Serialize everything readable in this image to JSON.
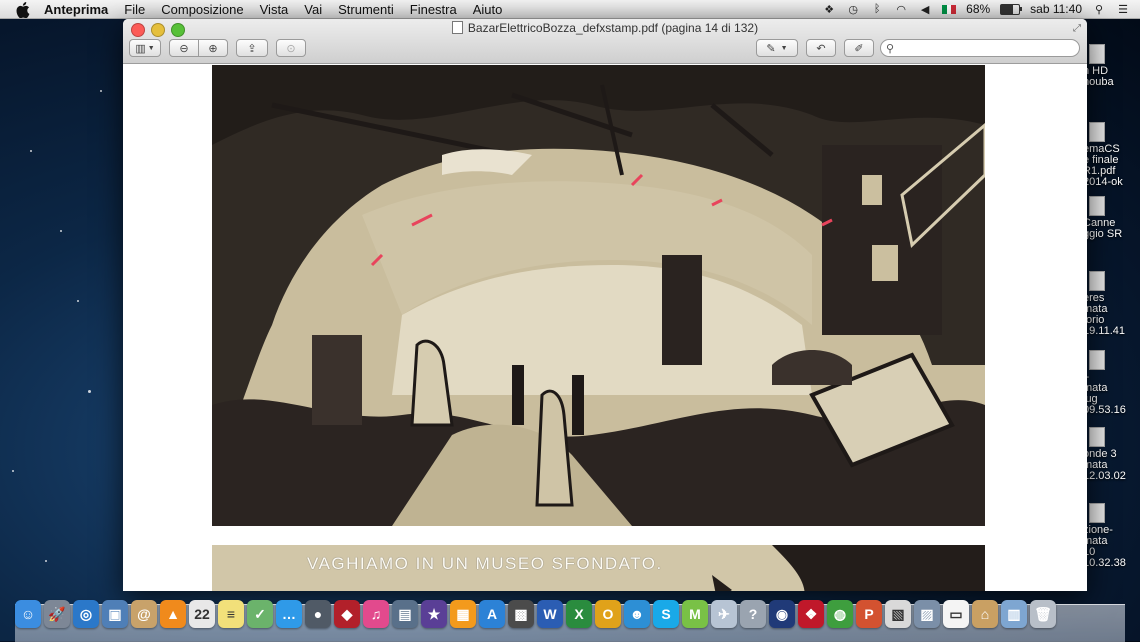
{
  "menubar": {
    "app_name": "Anteprima",
    "items": [
      "File",
      "Composizione",
      "Vista",
      "Vai",
      "Strumenti",
      "Finestra",
      "Aiuto"
    ],
    "battery_percent": "68%",
    "battery_level": 0.68,
    "clock": "sab 11:40",
    "flag_colors": [
      "#009246",
      "#ffffff",
      "#ce2b37"
    ]
  },
  "window": {
    "title": "BazarElettricoBozza_defxstamp.pdf (pagina 14 di 132)",
    "search_placeholder": ""
  },
  "page": {
    "caption": "VAGHIAMO IN UN MUSEO SFONDATO."
  },
  "desktop_icons": [
    {
      "lines": [
        "n HD",
        "houba"
      ]
    },
    {
      "lines": [
        "emaCS",
        "e finale",
        "R1.pdf",
        "2014-ok"
      ]
    },
    {
      "lines": [
        "Canne",
        "ggio SR"
      ]
    },
    {
      "lines": [
        "ères",
        "mata",
        "torio",
        "19.11.41"
      ]
    },
    {
      "lines": [
        "i-",
        "mata",
        "lug",
        "09.53.16"
      ]
    },
    {
      "lines": [
        "onde 3",
        "mata",
        "12.03.02"
      ]
    },
    {
      "lines": [
        "zione-",
        "mata",
        "10",
        "10.32.38"
      ]
    }
  ],
  "dock": {
    "apps": [
      {
        "name": "finder",
        "glyph": "☺",
        "color": "#3b8de0"
      },
      {
        "name": "launchpad",
        "glyph": "🚀",
        "color": "#7d8796"
      },
      {
        "name": "safari",
        "glyph": "◎",
        "color": "#2b78c9"
      },
      {
        "name": "preview",
        "glyph": "▣",
        "color": "#4f7fb7"
      },
      {
        "name": "contacts",
        "glyph": "@",
        "color": "#c8a26a"
      },
      {
        "name": "vlc",
        "glyph": "▲",
        "color": "#f08a1c"
      },
      {
        "name": "calendar",
        "glyph": "22",
        "color": "#e8e8e8"
      },
      {
        "name": "notes",
        "glyph": "≡",
        "color": "#f2e07a"
      },
      {
        "name": "maps",
        "glyph": "✓",
        "color": "#6bb36b"
      },
      {
        "name": "messages",
        "glyph": "…",
        "color": "#2f9ae8"
      },
      {
        "name": "facetime",
        "glyph": "●",
        "color": "#505a66"
      },
      {
        "name": "photo-booth",
        "glyph": "◆",
        "color": "#b2202a"
      },
      {
        "name": "itunes",
        "glyph": "♫",
        "color": "#e24a8d"
      },
      {
        "name": "iphoto",
        "glyph": "▤",
        "color": "#59708a"
      },
      {
        "name": "imovie",
        "glyph": "★",
        "color": "#5a3f96"
      },
      {
        "name": "ibooks",
        "glyph": "▦",
        "color": "#f39a1c"
      },
      {
        "name": "app-store",
        "glyph": "A",
        "color": "#2c82d6"
      },
      {
        "name": "mission-control",
        "glyph": "▩",
        "color": "#4b4b4b"
      },
      {
        "name": "word",
        "glyph": "W",
        "color": "#2b5db3"
      },
      {
        "name": "excel",
        "glyph": "X",
        "color": "#2a8c3e"
      },
      {
        "name": "outlook",
        "glyph": "O",
        "color": "#e0a21a"
      },
      {
        "name": "messenger",
        "glyph": "☻",
        "color": "#2d8fd5"
      },
      {
        "name": "skype",
        "glyph": "S",
        "color": "#19a9e8"
      },
      {
        "name": "movistar",
        "glyph": "M",
        "color": "#79c146"
      },
      {
        "name": "utility",
        "glyph": "✈",
        "color": "#b7c4d4"
      },
      {
        "name": "help",
        "glyph": "?",
        "color": "#9aa4b0"
      },
      {
        "name": "dvd-player",
        "glyph": "◉",
        "color": "#203a78"
      },
      {
        "name": "photo-app",
        "glyph": "❖",
        "color": "#c0182a"
      },
      {
        "name": "chrome",
        "glyph": "◍",
        "color": "#3e9e3e"
      },
      {
        "name": "powerpoint",
        "glyph": "P",
        "color": "#d35230"
      },
      {
        "name": "stickies",
        "glyph": "▧",
        "color": "#d9d9d9"
      },
      {
        "name": "image-viewer",
        "glyph": "▨",
        "color": "#7b8fa8"
      },
      {
        "name": "document",
        "glyph": "▭",
        "color": "#f4f4f4"
      },
      {
        "name": "home-folder",
        "glyph": "⌂",
        "color": "#c9a063"
      },
      {
        "name": "applications-folder",
        "glyph": "▥",
        "color": "#7ea6d1"
      },
      {
        "name": "trash",
        "glyph": "🗑",
        "color": "#b8bfc8"
      }
    ]
  }
}
